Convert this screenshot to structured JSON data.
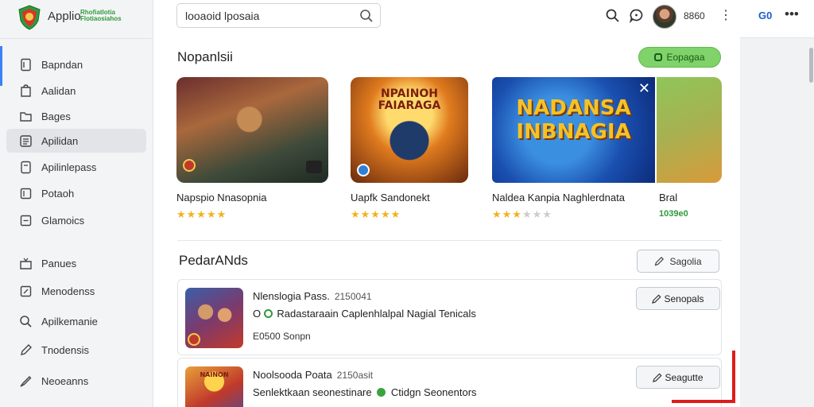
{
  "app": {
    "title": "Applio",
    "subtitle_line1": "Rhofiatlotia",
    "subtitle_line2": "Flotiaosiahos"
  },
  "sidebar": {
    "items": [
      {
        "label": "Bapndan",
        "icon": "document-icon"
      },
      {
        "label": "Aalidan",
        "icon": "bag-icon"
      },
      {
        "label": "Bages",
        "icon": "folder-icon"
      },
      {
        "label": "Apilidan",
        "icon": "list-icon",
        "active": true
      },
      {
        "label": "Apilinlepass",
        "icon": "tablet-icon"
      },
      {
        "label": "Potaoh",
        "icon": "box-icon"
      },
      {
        "label": "Glamoics",
        "icon": "grid-icon"
      },
      {
        "label": "Panues",
        "icon": "inbox-icon"
      },
      {
        "label": "Menodenss",
        "icon": "edit-icon"
      },
      {
        "label": "Apilkemanie",
        "icon": "search-icon"
      },
      {
        "label": "Tnodensis",
        "icon": "pencil-icon"
      },
      {
        "label": "Neoeanns",
        "icon": "brush-icon"
      }
    ]
  },
  "header": {
    "search_value": "looaoid lposaia",
    "search_placeholder": "Search",
    "count": "8860",
    "right_label": "G0",
    "more": "•••"
  },
  "featured": {
    "title": "Nopanlsii",
    "button_label": "Eopagaa",
    "cards": [
      {
        "name": "Napspio Nnasopnia",
        "rating": 5,
        "max": 5,
        "badge_text": ""
      },
      {
        "name": "Uapfk Sandonekt",
        "rating": 5,
        "max": 5,
        "overlay": "NPAINOH\nFAIARAGA"
      },
      {
        "name": "Naldea Kanpia Naghlerdnata",
        "rating": 3.5,
        "max": 6,
        "overlay": "NADANSA\nINBNAGIA",
        "close": "✕"
      },
      {
        "name": "Bral",
        "price": "1039e0"
      }
    ]
  },
  "list": {
    "title": "PedarANds",
    "button_label": "Sagolia",
    "rows": [
      {
        "title": "Nlenslogia Pass.",
        "meta": "2150041",
        "desc_pre": "O",
        "desc": "Radastaraain Caplenhlalpal Nagial Tenicals",
        "foot": "E0500 Sonpn",
        "button": "Senopals"
      },
      {
        "title": "Noolsooda Poata",
        "meta": "2150asit",
        "desc_pre": "Senlektkaan seonestinare",
        "desc": "Ctidgn Seonentors",
        "foot": "",
        "button": "Seagutte"
      }
    ]
  },
  "colors": {
    "accent": "#3b82f6",
    "green": "#7fd36a",
    "star": "#f2b21b",
    "red_marker": "#e01b1b"
  }
}
